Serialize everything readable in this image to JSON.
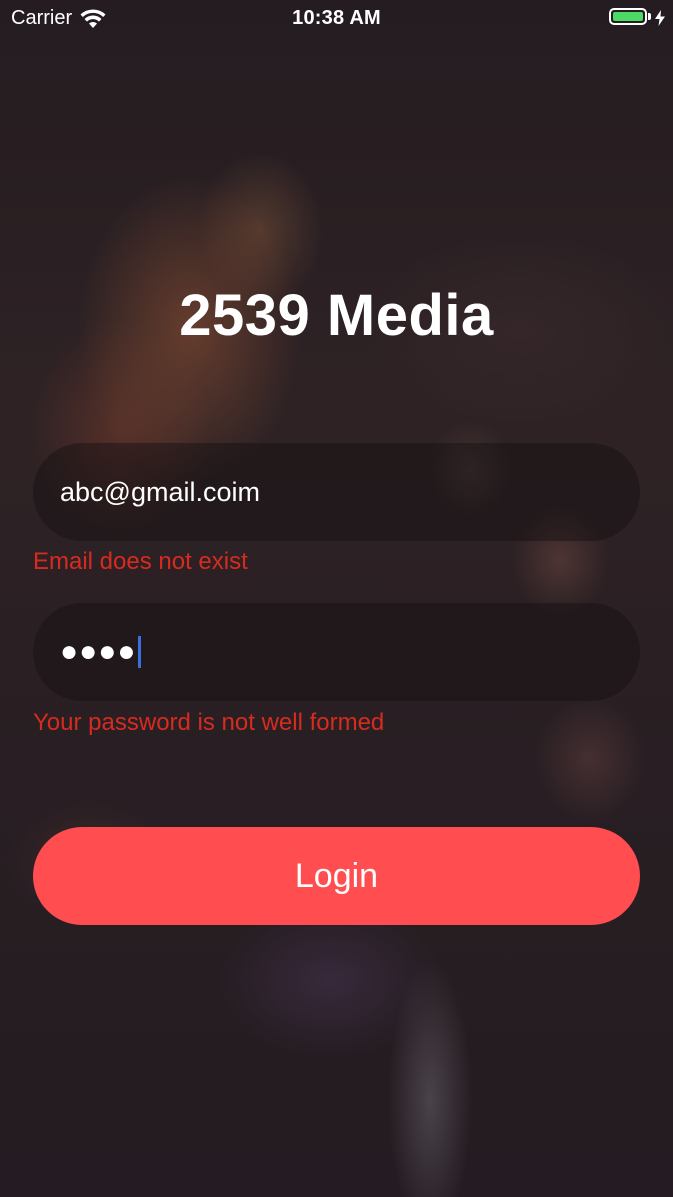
{
  "status_bar": {
    "carrier": "Carrier",
    "time": "10:38 AM",
    "battery_color": "#4cd964"
  },
  "app": {
    "title": "2539 Media"
  },
  "form": {
    "email": {
      "value": "abc@gmail.coim",
      "error": "Email does not exist"
    },
    "password": {
      "masked_value": "●●●●",
      "error": "Your password is not well formed"
    },
    "login_label": "Login"
  },
  "colors": {
    "accent": "#ff4d50",
    "error": "#d62b1f",
    "cursor": "#3b6fe0"
  },
  "icons": [
    "wifi-icon",
    "battery-icon",
    "charging-bolt-icon"
  ]
}
